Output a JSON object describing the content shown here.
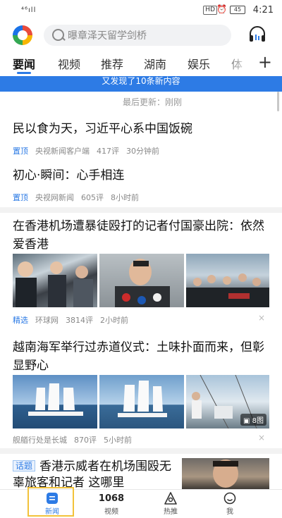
{
  "status_bar": {
    "signal": "⁴⁶ıll",
    "hd": "HD",
    "battery": "45",
    "time": "4:21"
  },
  "search": {
    "placeholder": "曝章泽天留学剑桥"
  },
  "tabs": [
    {
      "label": "要闻",
      "active": true
    },
    {
      "label": "视频"
    },
    {
      "label": "推荐"
    },
    {
      "label": "湖南"
    },
    {
      "label": "娱乐"
    },
    {
      "label": "体"
    }
  ],
  "tabs_add": "+",
  "refresh_banner": "又发现了10条新内容",
  "last_update": "最后更新：刚刚",
  "articles": [
    {
      "title": "民以食为天，习近平心系中国饭碗",
      "tag": "置顶",
      "source": "央视新闻客户端",
      "comments": "417评",
      "time": "30分钟前"
    },
    {
      "title": "初心·瞬间：心手相连",
      "tag": "置顶",
      "source": "央视网新闻",
      "comments": "605评",
      "time": "8小时前"
    },
    {
      "title": "在香港机场遭暴徒殴打的记者付国豪出院：依然爱香港",
      "tag": "精选",
      "source": "环球网",
      "comments": "3814评",
      "time": "2小时前",
      "close": "×"
    },
    {
      "title": "越南海军举行过赤道仪式：土味扑面而来，但彰显野心",
      "tag": "",
      "source": "舰艏行处是长城",
      "comments": "870评",
      "time": "5小时前",
      "close": "×",
      "photo_count": "8图"
    },
    {
      "title": "香港示威者在机场围殴无辜旅客和记者 这哪里",
      "tag": "话题"
    }
  ],
  "bottom_nav": [
    {
      "label": "新闻",
      "icon": "news-icon",
      "active": true
    },
    {
      "label": "视频",
      "icon": "video-1068-icon",
      "glyph": "1068"
    },
    {
      "label": "热推",
      "icon": "hot-icon"
    },
    {
      "label": "我",
      "icon": "me-icon"
    }
  ],
  "colors": {
    "accent": "#2d7be5",
    "tag_blue": "#2d7be5",
    "highlight_box": "#f2c23a"
  }
}
